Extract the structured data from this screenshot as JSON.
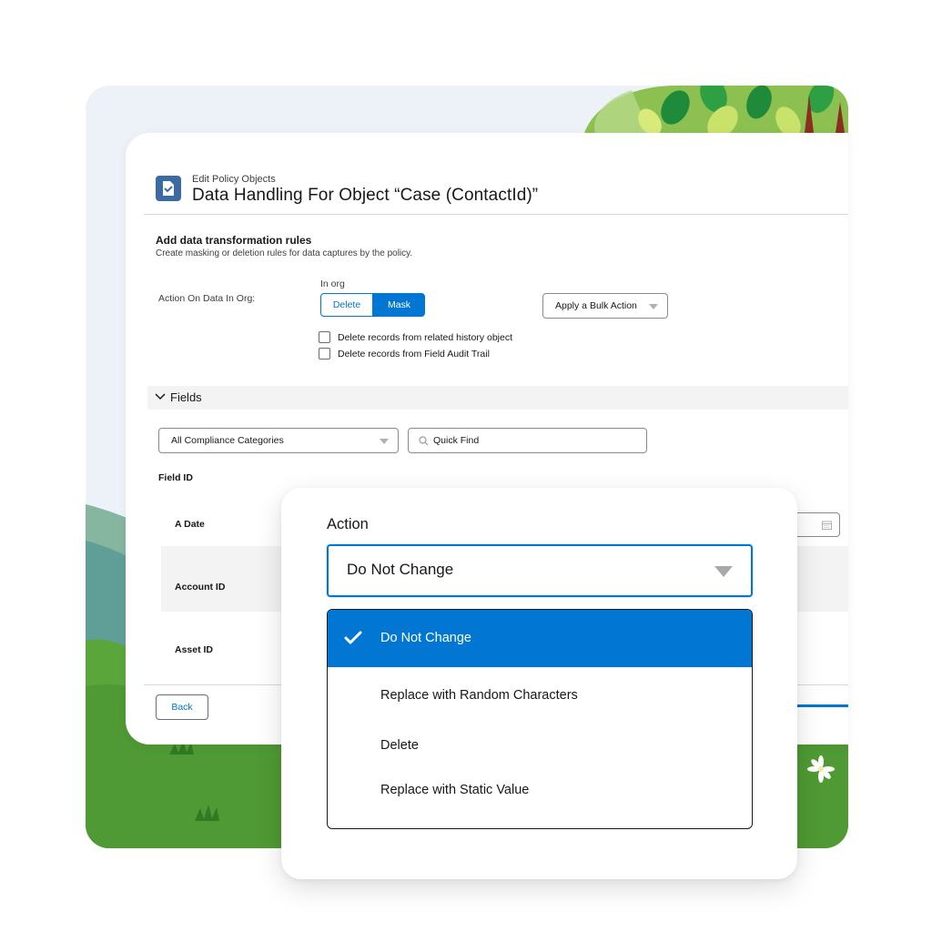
{
  "header": {
    "breadcrumb": "Edit Policy Objects",
    "title": "Data Handling For Object “Case (ContactId)”"
  },
  "rules": {
    "title": "Add data transformation rules",
    "subtitle": "Create masking or deletion rules for data captures by the policy.",
    "action_label": "Action On Data In Org:",
    "in_org_label": "In org",
    "segment": {
      "delete_label": "Delete",
      "mask_label": "Mask",
      "selected": "Mask"
    },
    "bulk_action_label": "Apply a Bulk Action",
    "checkboxes": [
      {
        "label": "Delete records from related history object",
        "checked": false
      },
      {
        "label": "Delete records from Field Audit Trail",
        "checked": false
      }
    ]
  },
  "fields": {
    "section_label": "Fields",
    "category_filter": "All Compliance Categories",
    "quick_find_placeholder": "Quick Find",
    "column_header": "Field ID",
    "rows": [
      "A Date",
      "Account ID",
      "Asset ID"
    ]
  },
  "footer": {
    "back_label": "Back"
  },
  "action_dropdown": {
    "label": "Action",
    "selected_value": "Do Not Change",
    "options": [
      {
        "label": "Do Not Change",
        "selected": true
      },
      {
        "label": "Replace with Random Characters",
        "selected": false
      },
      {
        "label": "Delete",
        "selected": false
      },
      {
        "label": "Replace with Static Value",
        "selected": false
      }
    ]
  },
  "colors": {
    "brand_blue": "#0176d3",
    "icon_blue": "#3b6ba5",
    "grass_green": "#5aa63b",
    "hill_teal": "#5f9f97"
  },
  "icons": {
    "header": "policy-document-icon",
    "check": "checkmark-icon",
    "search": "search-icon",
    "calendar": "calendar-icon",
    "chevron": "chevron-down-icon"
  }
}
